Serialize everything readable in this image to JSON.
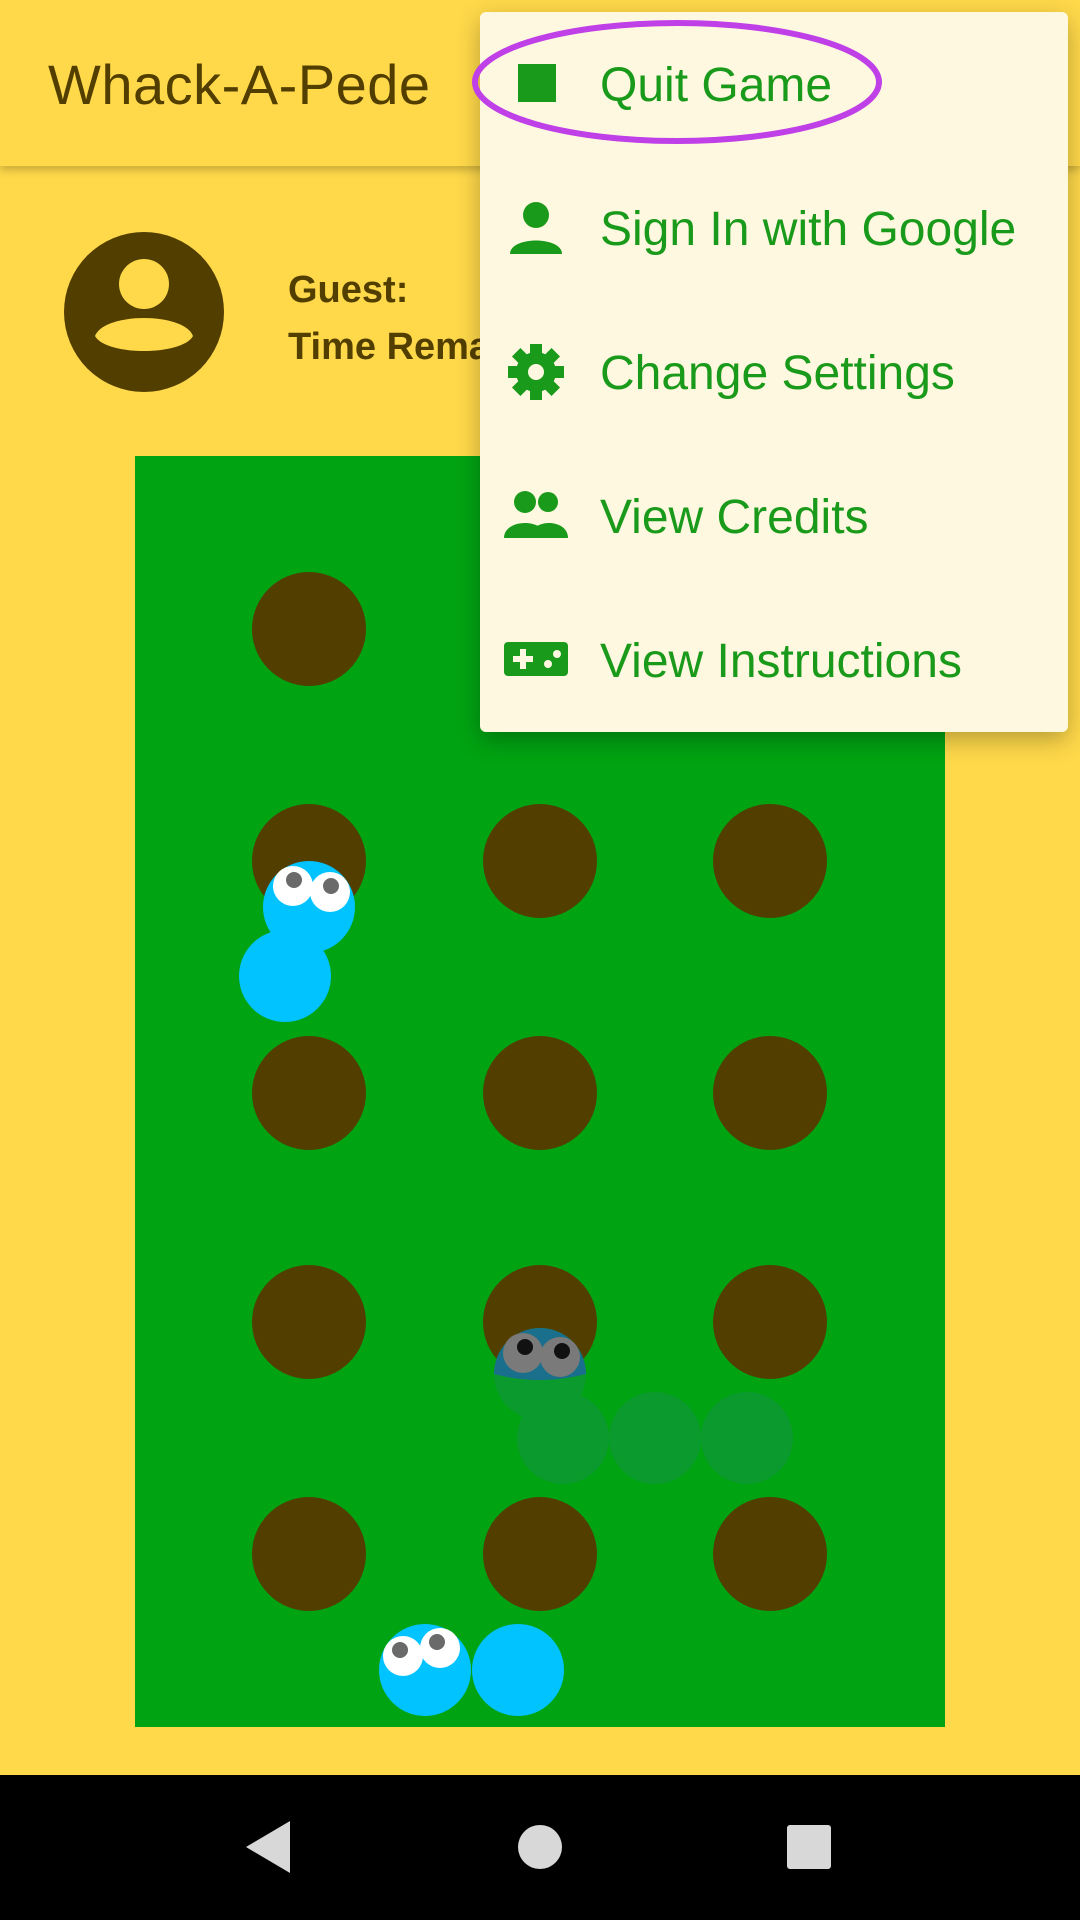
{
  "app_bar": {
    "title": "Whack-A-Pede"
  },
  "player": {
    "name_label": "Guest:",
    "time_label": "Time Remaining:"
  },
  "menu": {
    "items": [
      {
        "id": "quit",
        "label": "Quit Game",
        "icon": "stop-square-icon"
      },
      {
        "id": "sign-in",
        "label": "Sign In with Google",
        "icon": "person-icon"
      },
      {
        "id": "settings",
        "label": "Change Settings",
        "icon": "gear-icon"
      },
      {
        "id": "credits",
        "label": "View Credits",
        "icon": "people-icon"
      },
      {
        "id": "instructions",
        "label": "View Instructions",
        "icon": "gamepad-icon"
      }
    ],
    "highlighted_item": "Quit Game"
  },
  "board": {
    "hole_grid": {
      "rows": 5,
      "cols": 3
    },
    "centipedes": [
      {
        "color": "light-blue",
        "state": "visible",
        "segments": 2
      },
      {
        "color": "dark-blue",
        "state": "underground",
        "segments": 4
      },
      {
        "color": "light-blue",
        "state": "visible",
        "segments": 2
      }
    ]
  },
  "nav_bar": {
    "buttons": [
      "back-icon",
      "home-icon",
      "recents-icon"
    ]
  },
  "colors": {
    "background": "#FFD94A",
    "text_dark": "#523F00",
    "board_green": "#00A312",
    "hole_brown": "#523F00",
    "centipede_blue": "#00C3FF",
    "menu_bg": "#FFF8E1",
    "menu_text": "#1A9A1A",
    "highlight_purple": "#C040E8"
  }
}
